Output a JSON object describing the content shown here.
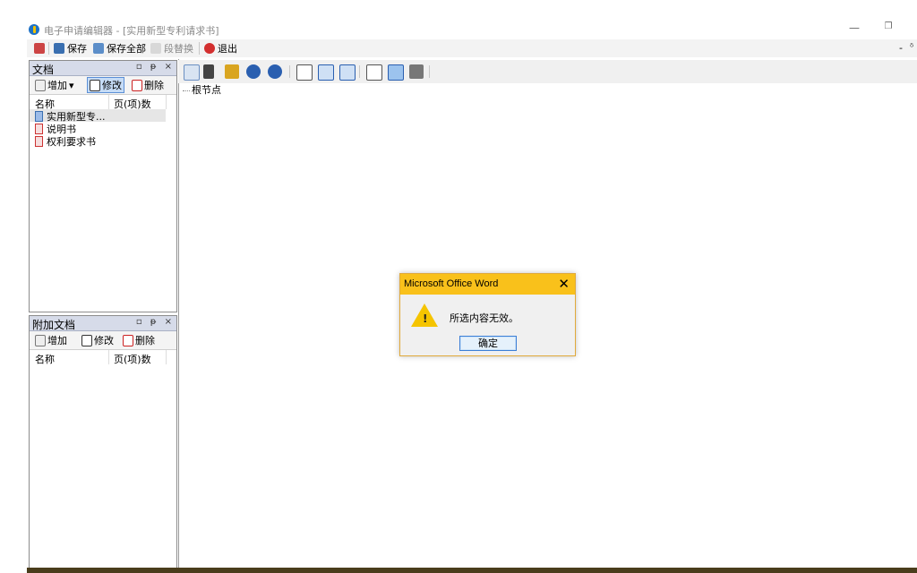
{
  "window": {
    "title": "电子申请编辑器 - [实用新型专利请求书]",
    "minimize_glyph": "—",
    "restore_glyph": "❐"
  },
  "menubar": {
    "items": [
      {
        "label": "保存",
        "icon": "save-icon"
      },
      {
        "label": "保存全部",
        "icon": "save-all-icon"
      },
      {
        "label": "段替换",
        "icon": "replace-icon"
      },
      {
        "label": "退出",
        "icon": "exit-icon"
      }
    ],
    "mdi_min": "-",
    "mdi_restore": "ᵟ"
  },
  "doc_panel": {
    "title": "文档",
    "ctrls": "▫ ᵽ ×",
    "toolbar": {
      "add": "增加",
      "edit": "修改",
      "delete": "删除",
      "dropdown": "▾"
    },
    "columns": [
      "名称",
      "页(项)数"
    ],
    "rows": [
      {
        "name": "实用新型专..."
      },
      {
        "name": "说明书"
      },
      {
        "name": "权利要求书"
      }
    ]
  },
  "attach_panel": {
    "title": "附加文档",
    "ctrls": "▫ ᵽ ×",
    "toolbar": {
      "add": "增加",
      "edit": "修改",
      "delete": "删除"
    },
    "columns": [
      "名称",
      "页(项)数"
    ]
  },
  "editor": {
    "tree_root": "根节点"
  },
  "dialog": {
    "title": "Microsoft Office Word",
    "close": "✕",
    "warn_mark": "!",
    "message": "所选内容无效。",
    "ok": "确定"
  },
  "colors": {
    "dialog_title": "#f9c11b",
    "panel_title": "#d6dbe9",
    "warning": "#f5c400",
    "accent": "#1e72c6"
  }
}
